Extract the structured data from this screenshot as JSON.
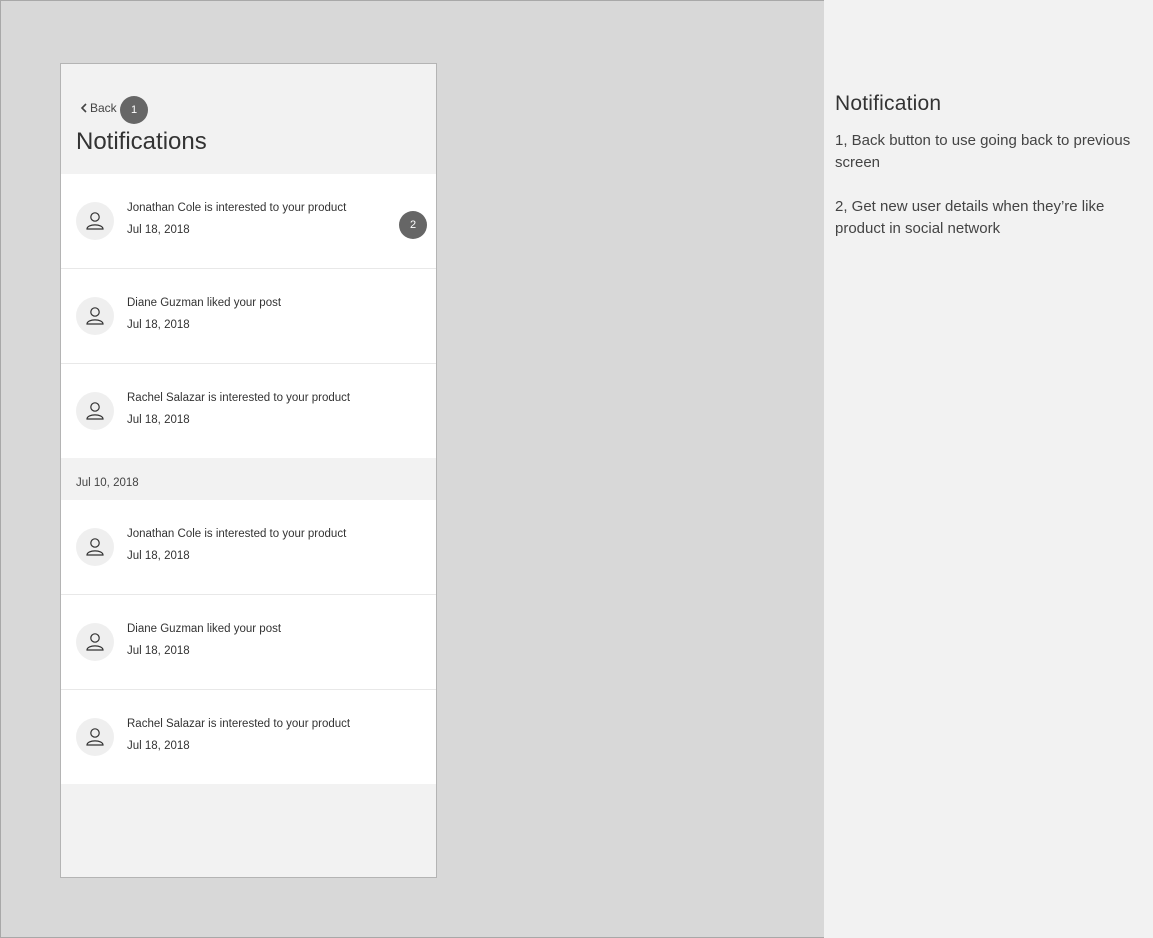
{
  "screen": {
    "back_label": "Back",
    "title": "Notifications",
    "markers": [
      "1",
      "2"
    ]
  },
  "notifications_recent": [
    {
      "message": "Jonathan Cole is interested to your product",
      "date": "Jul 18, 2018",
      "icon": "user-icon"
    },
    {
      "message": "Diane Guzman liked your post",
      "date": "Jul 18, 2018",
      "icon": "user-icon"
    },
    {
      "message": "Rachel Salazar is interested to your product",
      "date": "Jul 18, 2018",
      "icon": "user-icon"
    }
  ],
  "section_date": "Jul 10, 2018",
  "notifications_older": [
    {
      "message": "Jonathan Cole is interested to your product",
      "date": "Jul 18, 2018",
      "icon": "user-icon"
    },
    {
      "message": "Diane Guzman liked your post",
      "date": "Jul 18, 2018",
      "icon": "user-icon"
    },
    {
      "message": "Rachel Salazar is interested to your product",
      "date": "Jul 18, 2018",
      "icon": "user-icon"
    }
  ],
  "notes": {
    "title": "Notification",
    "items": [
      "1, Back button to use going back to previous screen",
      "2, Get new user details when they’re like product in social network"
    ]
  },
  "colors": {
    "canvas": "#d8d8d8",
    "panel": "#f2f2f2",
    "card": "#ffffff",
    "marker": "#666666"
  }
}
